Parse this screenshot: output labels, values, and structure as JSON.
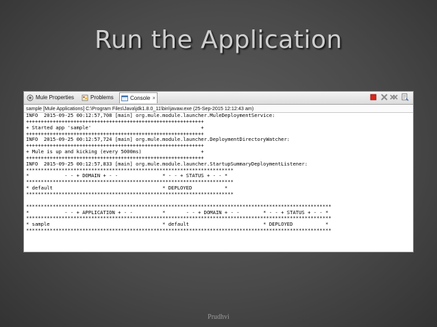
{
  "slide": {
    "title": "Run the Application",
    "footer": "Prudhvi"
  },
  "tabs": [
    {
      "label": "Mule Properties",
      "icon": "mule-properties-icon"
    },
    {
      "label": "Problems",
      "icon": "problems-icon"
    },
    {
      "label": "Console",
      "icon": "console-icon",
      "active": true,
      "close": "×"
    }
  ],
  "console": {
    "description": "sample [Mule Applications] C:\\Program Files\\Java\\jdk1.8.0_11\\bin\\javaw.exe (25-Sep-2015 12:12:43 am)",
    "lines": [
      "INFO  2015-09-25 00:12:57,708 [main] org.mule.module.launcher.MuleDeploymentService:",
      "++++++++++++++++++++++++++++++++++++++++++++++++++++++++++++",
      "+ Started app 'sample'                                     +",
      "++++++++++++++++++++++++++++++++++++++++++++++++++++++++++++",
      "INFO  2015-09-25 00:12:57,724 [main] org.mule.module.launcher.DeploymentDirectoryWatcher:",
      "++++++++++++++++++++++++++++++++++++++++++++++++++++++++++++",
      "+ Mule is up and kicking (every 5000ms)                    +",
      "++++++++++++++++++++++++++++++++++++++++++++++++++++++++++++",
      "INFO  2015-09-25 00:12:57,833 [main] org.mule.module.launcher.StartupSummaryDeploymentListener:",
      "**********************************************************************",
      "*            - - + DOMAIN + - -               * - - + STATUS + - - *",
      "**********************************************************************",
      "* default                                     * DEPLOYED           *",
      "**********************************************************************",
      "",
      "*******************************************************************************************************",
      "*            - - + APPLICATION + - -          *       - - + DOMAIN + - -        * - - + STATUS + - - *",
      "*******************************************************************************************************",
      "* sample                                      * default                         * DEPLOYED           *",
      "*******************************************************************************************************"
    ]
  },
  "colors": {
    "background": "#4a4a4a",
    "title": "#cfcfcf",
    "terminate_button": "#d9261c"
  }
}
